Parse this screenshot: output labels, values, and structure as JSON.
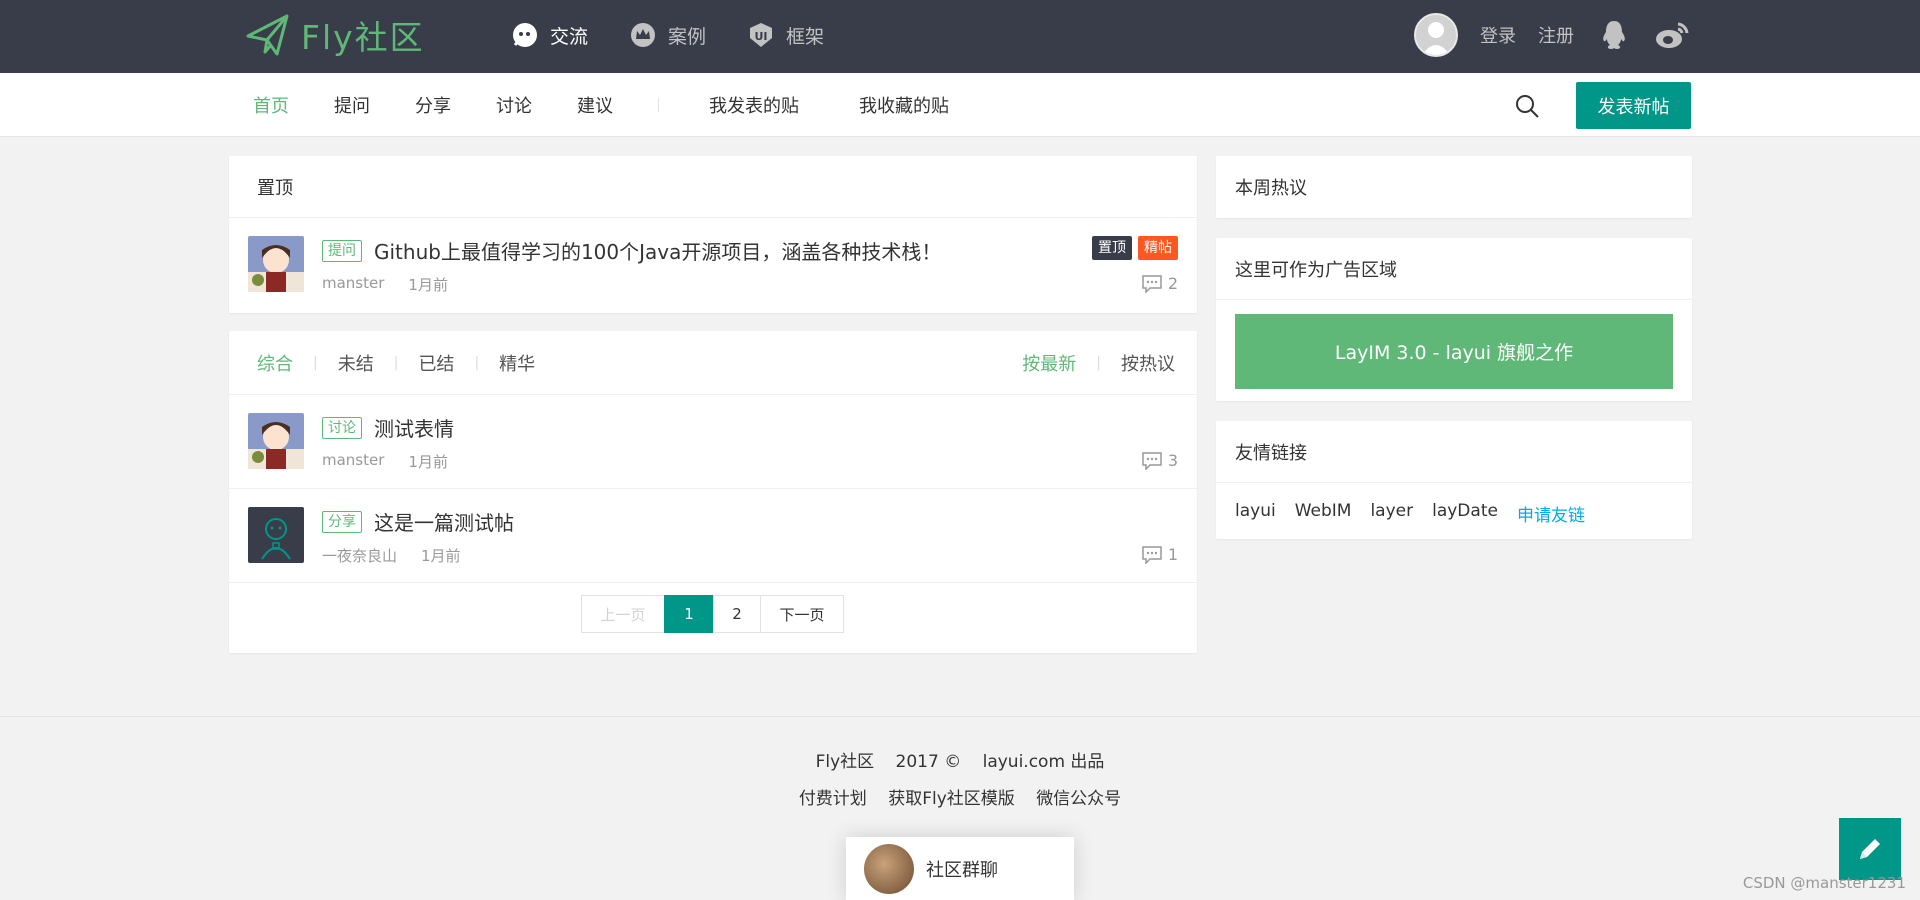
{
  "header": {
    "logo_text": "Fly社区",
    "nav": [
      {
        "label": "交流",
        "icon": "chat-bubble-icon",
        "active": true
      },
      {
        "label": "案例",
        "icon": "crown-icon",
        "active": false
      },
      {
        "label": "框架",
        "icon": "ui-shield-icon",
        "active": false
      }
    ],
    "login": "登录",
    "register": "注册"
  },
  "subnav": {
    "items": [
      "首页",
      "提问",
      "分享",
      "讨论",
      "建议"
    ],
    "mine": [
      "我发表的贴",
      "我收藏的贴"
    ],
    "post_button": "发表新帖"
  },
  "sticky": {
    "title": "置顶",
    "post": {
      "tag": "提问",
      "title": "Github上最值得学习的100个Java开源项目，涵盖各种技术栈！",
      "author": "manster",
      "time": "1月前",
      "badges": [
        "置顶",
        "精帖"
      ],
      "replies": "2"
    }
  },
  "list": {
    "filters_left": [
      "综合",
      "未结",
      "已结",
      "精华"
    ],
    "filters_right": [
      "按最新",
      "按热议"
    ],
    "posts": [
      {
        "tag": "讨论",
        "title": "测试表情",
        "author": "manster",
        "time": "1月前",
        "replies": "3"
      },
      {
        "tag": "分享",
        "title": "这是一篇测试帖",
        "author": "一夜奈良山",
        "time": "1月前",
        "replies": "1"
      }
    ],
    "pager": {
      "prev": "上一页",
      "pages": [
        "1",
        "2"
      ],
      "next": "下一页"
    }
  },
  "sidebar": {
    "hot_title": "本周热议",
    "ad_title": "这里可作为广告区域",
    "ad_banner": "LayIM 3.0 - layui 旗舰之作",
    "links_title": "友情链接",
    "links": [
      "layui",
      "WebIM",
      "layer",
      "layDate"
    ],
    "apply_link": "申请友链"
  },
  "footer": {
    "line1": [
      "Fly社区",
      "2017 ©",
      "layui.com 出品"
    ],
    "line2": [
      "付费计划",
      "获取Fly社区模版",
      "微信公众号"
    ]
  },
  "chat": {
    "label": "社区群聊"
  },
  "watermark": "CSDN @manster1231",
  "colors": {
    "header_bg": "#393d49",
    "accent_green": "#5fb878",
    "primary_teal": "#009688",
    "hot_orange": "#ff5722",
    "link_blue": "#01aaed"
  }
}
